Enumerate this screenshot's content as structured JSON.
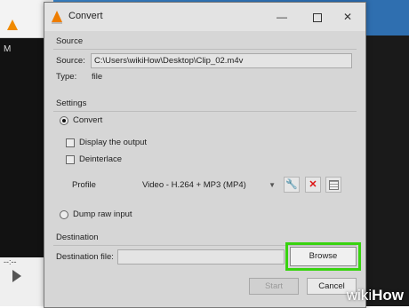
{
  "background": {
    "player_menu_text": "M",
    "time_label": "--:--"
  },
  "dialog": {
    "title": "Convert",
    "window_controls": {
      "minimize": "—",
      "maximize": "☐",
      "close": "✕"
    },
    "source": {
      "section": "Source",
      "source_label": "Source:",
      "source_value": "C:\\Users\\wikiHow\\Desktop\\Clip_02.m4v",
      "type_label": "Type:",
      "type_value": "file"
    },
    "settings": {
      "section": "Settings",
      "convert_label": "Convert",
      "convert_selected": true,
      "display_output_label": "Display the output",
      "deinterlace_label": "Deinterlace",
      "profile_label": "Profile",
      "profile_value": "Video - H.264 + MP3 (MP4)",
      "dump_raw_label": "Dump raw input"
    },
    "destination": {
      "section": "Destination",
      "file_label": "Destination file:",
      "file_value": "",
      "browse_label": "Browse"
    },
    "buttons": {
      "start": "Start",
      "cancel": "Cancel"
    }
  },
  "watermark": {
    "brand_a": "wiki",
    "brand_b": "How"
  },
  "colors": {
    "highlight": "#38d30f",
    "vlc_orange": "#ee7d00",
    "delete_red": "#d11111"
  },
  "icons": [
    "vlc-cone-icon",
    "wrench-icon",
    "delete-x-icon",
    "grid-icon",
    "chevron-down-icon",
    "play-icon"
  ]
}
